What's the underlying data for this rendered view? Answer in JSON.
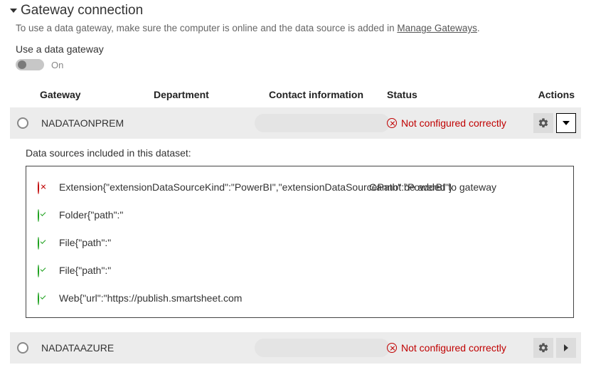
{
  "header": {
    "title": "Gateway connection",
    "help_prefix": "To use a data gateway, make sure the computer is online and the data source is added in ",
    "help_link_label": "Manage Gateways",
    "help_suffix": "."
  },
  "toggle": {
    "label": "Use a data gateway",
    "state_label": "On"
  },
  "columns": {
    "gateway": "Gateway",
    "department": "Department",
    "contact": "Contact information",
    "status": "Status",
    "actions": "Actions"
  },
  "gateways": [
    {
      "name": "NADATAONPREM",
      "status_text": "Not configured correctly",
      "status_kind": "error",
      "expanded": true
    },
    {
      "name": "NADATAAZURE",
      "status_text": "Not configured correctly",
      "status_kind": "error",
      "expanded": false
    }
  ],
  "detail": {
    "heading": "Data sources included in this dataset:",
    "sources": [
      {
        "kind": "error",
        "text": "Extension{\"extensionDataSourceKind\":\"PowerBI\",\"extensionDataSourcePath\":\"PowerBI\"}",
        "status": "Cannot be added to gateway"
      },
      {
        "kind": "ok",
        "text": "Folder{\"path\":\"",
        "status": ""
      },
      {
        "kind": "ok",
        "text": "File{\"path\":\"",
        "status": ""
      },
      {
        "kind": "ok",
        "text": "File{\"path\":\"",
        "status": ""
      },
      {
        "kind": "ok",
        "text": "Web{\"url\":\"https://publish.smartsheet.com",
        "status": ""
      }
    ]
  }
}
